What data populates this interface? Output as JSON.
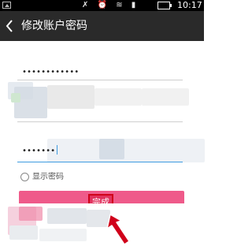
{
  "status_bar": {
    "time": "10:17",
    "icons": [
      "image-icon",
      "mute-icon",
      "alarm-icon",
      "wifi-icon",
      "signal-icon",
      "battery-icon"
    ],
    "icon_glyphs": "✗ ⏰ ≋ ▮"
  },
  "header": {
    "title": "修改账户密码",
    "back_icon": "back-arrow-icon"
  },
  "form": {
    "current_password_value": "••••••••••••",
    "new_password_value": "•••••••",
    "show_password_label": "显示密码",
    "show_password_checked": false
  },
  "actions": {
    "done_label": "完成"
  },
  "colors": {
    "header_bg": "#2a2a2a",
    "status_bg": "#000000",
    "button_bg": "#ef5a8a",
    "highlight_box": "#d0001a",
    "cursor": "#3d9be0"
  }
}
